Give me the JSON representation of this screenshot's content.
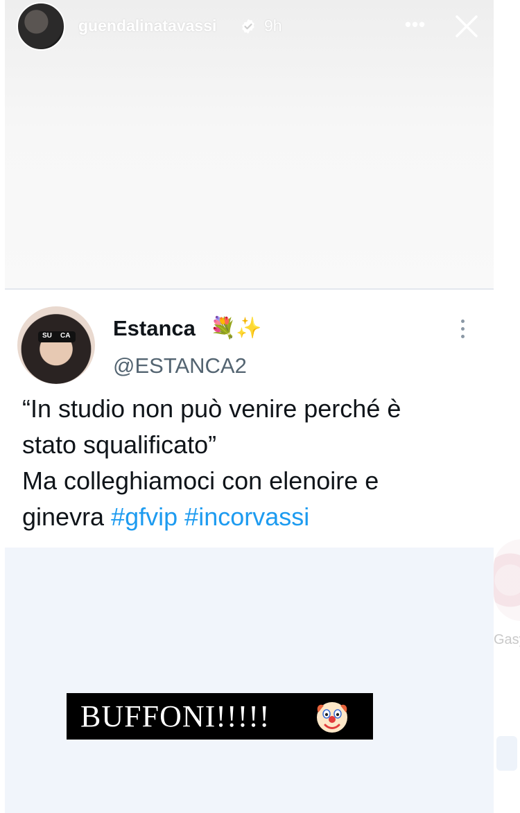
{
  "story": {
    "username": "guendalinatavassi",
    "time": "9h",
    "more_label": "•••",
    "verified_icon": "verified-badge-icon",
    "close_icon": "close-icon"
  },
  "tweet": {
    "display_name": "Estanca",
    "name_emojis": "💐✨",
    "handle": "@ESTANCA2",
    "avatar_glasses_text_left": "SU",
    "avatar_glasses_text_right": "CA",
    "lines": [
      "“In studio non può venire perché è",
      "stato squalificato”",
      "Ma colleghiamoci con elenoire e"
    ],
    "last_line_prefix": "ginevra ",
    "hashtags": [
      "#gfvip",
      "#incorvassi"
    ]
  },
  "caption": {
    "text": "BUFFONI!!!!!",
    "emoji_icon": "clown-face-icon"
  },
  "background_app": {
    "peek_label": "Gasy"
  },
  "colors": {
    "hashtag": "#1d9bf0",
    "handle": "#536471",
    "caption_bg": "#000000",
    "verified": "#ffffff"
  }
}
